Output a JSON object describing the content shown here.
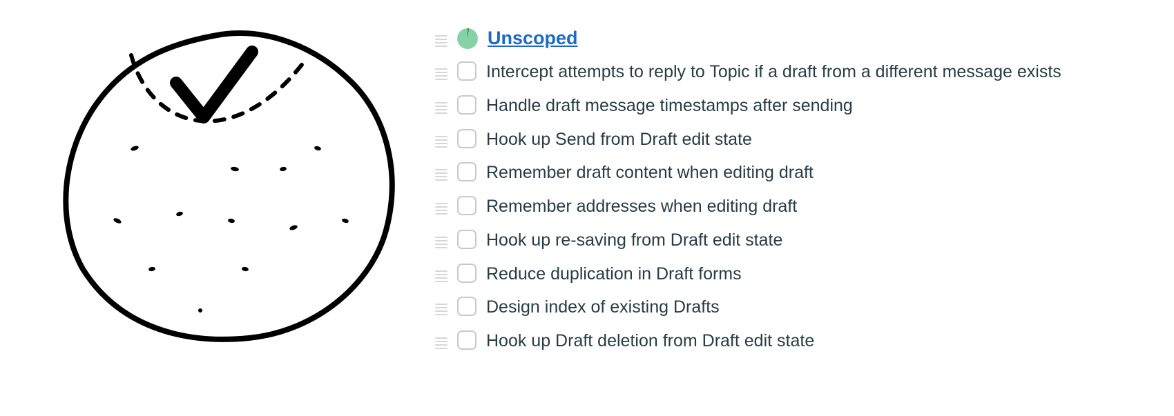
{
  "section": {
    "title": "Unscoped"
  },
  "tasks": [
    {
      "label": "Intercept attempts to reply to Topic if a draft from a different message exists"
    },
    {
      "label": "Handle draft message timestamps after sending"
    },
    {
      "label": "Hook up Send from Draft edit state"
    },
    {
      "label": "Remember draft content when editing draft"
    },
    {
      "label": "Remember addresses when editing draft"
    },
    {
      "label": "Hook up re-saving from Draft edit state"
    },
    {
      "label": "Reduce duplication in Draft forms"
    },
    {
      "label": "Design index of existing Drafts"
    },
    {
      "label": "Hook up Draft deletion from Draft edit state"
    }
  ]
}
